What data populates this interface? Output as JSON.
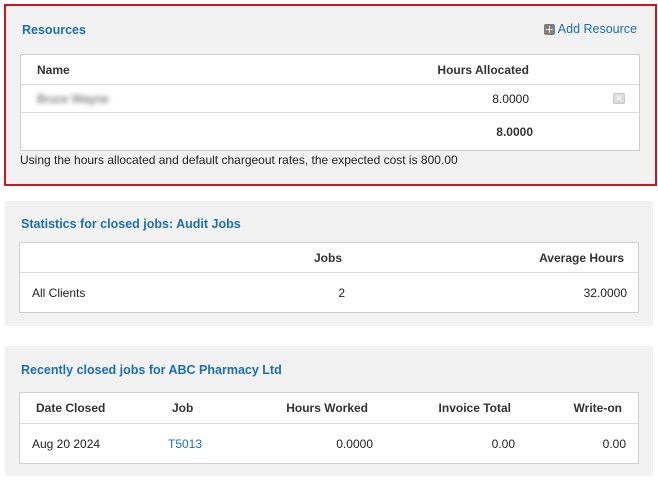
{
  "resources": {
    "title": "Resources",
    "add_label": "Add Resource",
    "columns": [
      "Name",
      "Hours Allocated"
    ],
    "rows": [
      {
        "name": "Bruce Wayne",
        "hours": "8.0000"
      }
    ],
    "total_hours": "8.0000",
    "note": "Using the hours allocated and default chargeout rates, the expected cost is 800.00"
  },
  "stats": {
    "title": "Statistics for closed jobs: Audit Jobs",
    "columns": [
      "",
      "Jobs",
      "Average Hours"
    ],
    "rows": [
      {
        "label": "All Clients",
        "jobs": "2",
        "avg_hours": "32.0000"
      }
    ]
  },
  "recent": {
    "title": "Recently closed jobs for ABC Pharmacy Ltd",
    "columns": [
      "Date Closed",
      "Job",
      "Hours Worked",
      "Invoice Total",
      "Write-on"
    ],
    "rows": [
      {
        "date": "Aug 20 2024",
        "job": "T5013",
        "hours": "0.0000",
        "invoice": "0.00",
        "write_on": "0.00"
      }
    ]
  }
}
